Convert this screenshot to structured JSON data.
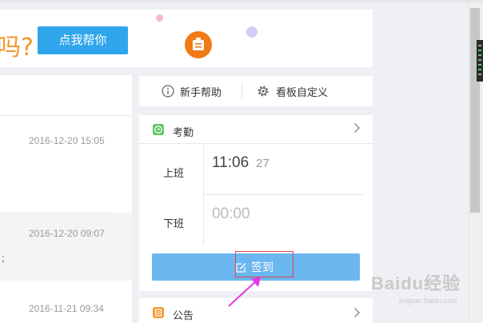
{
  "banner": {
    "question_mark": "吗?",
    "help_button": "点我帮你"
  },
  "left_list": {
    "items": [
      {
        "time": "2016-12-20 15:05"
      },
      {
        "time": "2016-12-20 09:07"
      },
      {
        "time": "2016-11-21 09:34"
      }
    ],
    "trailing_text": ";"
  },
  "toolbar": {
    "help_label": "新手帮助",
    "customize_label": "看板自定义"
  },
  "attendance": {
    "title": "考勤",
    "clock_in_label": "上班",
    "clock_in_time": "11:06",
    "clock_in_seconds": "27",
    "clock_out_label": "下班",
    "clock_out_time": "00:00",
    "sign_in_button": "签到"
  },
  "notice": {
    "title": "公告"
  },
  "watermark": {
    "main": "Baidu经验",
    "sub": "jingyan.baidu.com"
  },
  "colors": {
    "accent_blue": "#2fa5ec",
    "sign_button": "#6bb7ef",
    "attendance_icon": "#5cc45f",
    "notice_icon": "#f49a2b",
    "highlight_frame": "#e0454d",
    "pointer_arrow": "#e437e6"
  }
}
